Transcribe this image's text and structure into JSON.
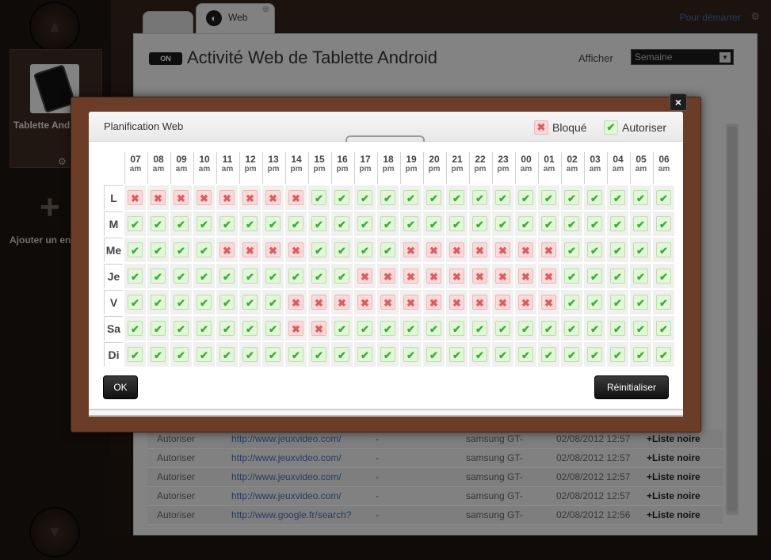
{
  "background": {
    "device_name": "Tablette Android",
    "add_label": "Ajouter un enfant",
    "top_link": "Pour démarrer",
    "web_tab_label": "Web",
    "on_badge": "ON",
    "page_title": "Activité Web de Tablette Android",
    "afficher_label": "Afficher",
    "period_select": "Semaine",
    "log_rows": [
      {
        "status": "Autoriser",
        "url": "http://www.jeuxvideo.com/",
        "category": "-",
        "device": "samsung GT-",
        "date": "02/08/2012 12:57",
        "action": "+Liste noire"
      },
      {
        "status": "Autoriser",
        "url": "http://www.jeuxvideo.com/",
        "category": "-",
        "device": "samsung GT-",
        "date": "02/08/2012 12:57",
        "action": "+Liste noire"
      },
      {
        "status": "Autoriser",
        "url": "http://www.jeuxvideo.com/",
        "category": "-",
        "device": "samsung GT-",
        "date": "02/08/2012 12:57",
        "action": "+Liste noire"
      },
      {
        "status": "Autoriser",
        "url": "http://www.jeuxvideo.com/",
        "category": "-",
        "device": "samsung GT-",
        "date": "02/08/2012 12:57",
        "action": "+Liste noire"
      },
      {
        "status": "Autoriser",
        "url": "http://www.google.fr/search?",
        "category": "-",
        "device": "samsung GT-",
        "date": "02/08/2012 12:56",
        "action": "+Liste noire"
      }
    ]
  },
  "modal": {
    "title": "Planification Web",
    "legend_blocked": "Bloqué",
    "legend_allowed": "Autoriser",
    "ok_label": "OK",
    "reset_label": "Réinitialiser",
    "close_label": "×"
  },
  "schedule": {
    "hours": [
      {
        "h": "07",
        "p": "am"
      },
      {
        "h": "08",
        "p": "am"
      },
      {
        "h": "09",
        "p": "am"
      },
      {
        "h": "10",
        "p": "am"
      },
      {
        "h": "11",
        "p": "am"
      },
      {
        "h": "12",
        "p": "pm"
      },
      {
        "h": "13",
        "p": "pm"
      },
      {
        "h": "14",
        "p": "pm"
      },
      {
        "h": "15",
        "p": "pm"
      },
      {
        "h": "16",
        "p": "pm"
      },
      {
        "h": "17",
        "p": "pm"
      },
      {
        "h": "18",
        "p": "pm"
      },
      {
        "h": "19",
        "p": "pm"
      },
      {
        "h": "20",
        "p": "pm"
      },
      {
        "h": "21",
        "p": "pm"
      },
      {
        "h": "22",
        "p": "pm"
      },
      {
        "h": "23",
        "p": "pm"
      },
      {
        "h": "00",
        "p": "am"
      },
      {
        "h": "01",
        "p": "am"
      },
      {
        "h": "02",
        "p": "am"
      },
      {
        "h": "03",
        "p": "am"
      },
      {
        "h": "04",
        "p": "am"
      },
      {
        "h": "05",
        "p": "am"
      },
      {
        "h": "06",
        "p": "am"
      }
    ],
    "days": [
      {
        "label": "L",
        "states": "BBBBBBBBAAAAAAAAAAAAAAAA"
      },
      {
        "label": "M",
        "states": "AAAAAAAAAAAAAAAAAAAAAAAA"
      },
      {
        "label": "Me",
        "states": "AAAABBBBAAAABBBBBBBAAAAA"
      },
      {
        "label": "Je",
        "states": "AAAAAAAAAABBBBBBBBBAAAAA"
      },
      {
        "label": "V",
        "states": "AAAAAAABBBBBBBBBBBBAAAAA"
      },
      {
        "label": "Sa",
        "states": "AAAAAAABBAAAAAAAAAAAAAAA"
      },
      {
        "label": "Di",
        "states": "AAAAAAAAAAAAAAAAAAAAAAAA"
      }
    ]
  },
  "colors": {
    "allowed": "#33b033",
    "blocked": "#e05c5c",
    "frame": "#6b3d27"
  }
}
